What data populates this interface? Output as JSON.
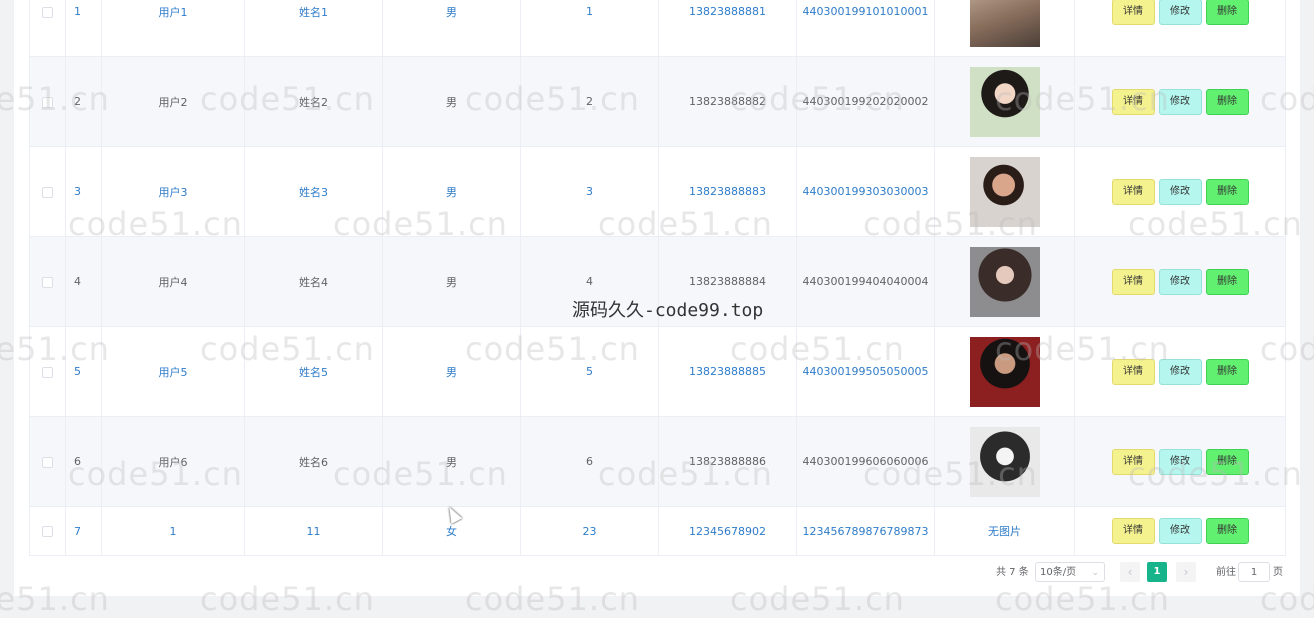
{
  "rows": [
    {
      "id": "1",
      "username": "用户1",
      "name": "姓名1",
      "gender": "男",
      "age": "1",
      "phone": "13823888881",
      "idcard": "440300199101010001",
      "avatar": "photo",
      "highlight": true
    },
    {
      "id": "2",
      "username": "用户2",
      "name": "姓名2",
      "gender": "男",
      "age": "2",
      "phone": "13823888882",
      "idcard": "440300199202020002",
      "avatar": "photo",
      "highlight": false
    },
    {
      "id": "3",
      "username": "用户3",
      "name": "姓名3",
      "gender": "男",
      "age": "3",
      "phone": "13823888883",
      "idcard": "440300199303030003",
      "avatar": "photo",
      "highlight": true
    },
    {
      "id": "4",
      "username": "用户4",
      "name": "姓名4",
      "gender": "男",
      "age": "4",
      "phone": "13823888884",
      "idcard": "440300199404040004",
      "avatar": "photo",
      "highlight": false
    },
    {
      "id": "5",
      "username": "用户5",
      "name": "姓名5",
      "gender": "男",
      "age": "5",
      "phone": "13823888885",
      "idcard": "440300199505050005",
      "avatar": "photo",
      "highlight": true
    },
    {
      "id": "6",
      "username": "用户6",
      "name": "姓名6",
      "gender": "男",
      "age": "6",
      "phone": "13823888886",
      "idcard": "440300199606060006",
      "avatar": "photo",
      "highlight": false
    },
    {
      "id": "7",
      "username": "1",
      "name": "11",
      "gender": "女",
      "age": "23",
      "phone": "12345678902",
      "idcard": "123456789876789873",
      "avatar_text": "无图片",
      "highlight": true
    }
  ],
  "actions": {
    "detail": "详情",
    "edit": "修改",
    "delete": "删除"
  },
  "pagination": {
    "total": "共 7 条",
    "page_size": "10条/页",
    "current_page": "1",
    "goto_label": "前往",
    "goto_value": "1",
    "page_unit": "页",
    "prev": "‹",
    "next": "›"
  },
  "watermark": {
    "repeat": "code51.cn",
    "center": "源码久久-code99.top"
  },
  "colors": {
    "link_blue": "#2f7cc9",
    "active_page": "#17b38a",
    "detail_btn": "#f4f28e",
    "edit_btn": "#b5f6ee",
    "delete_btn": "#62f070"
  }
}
